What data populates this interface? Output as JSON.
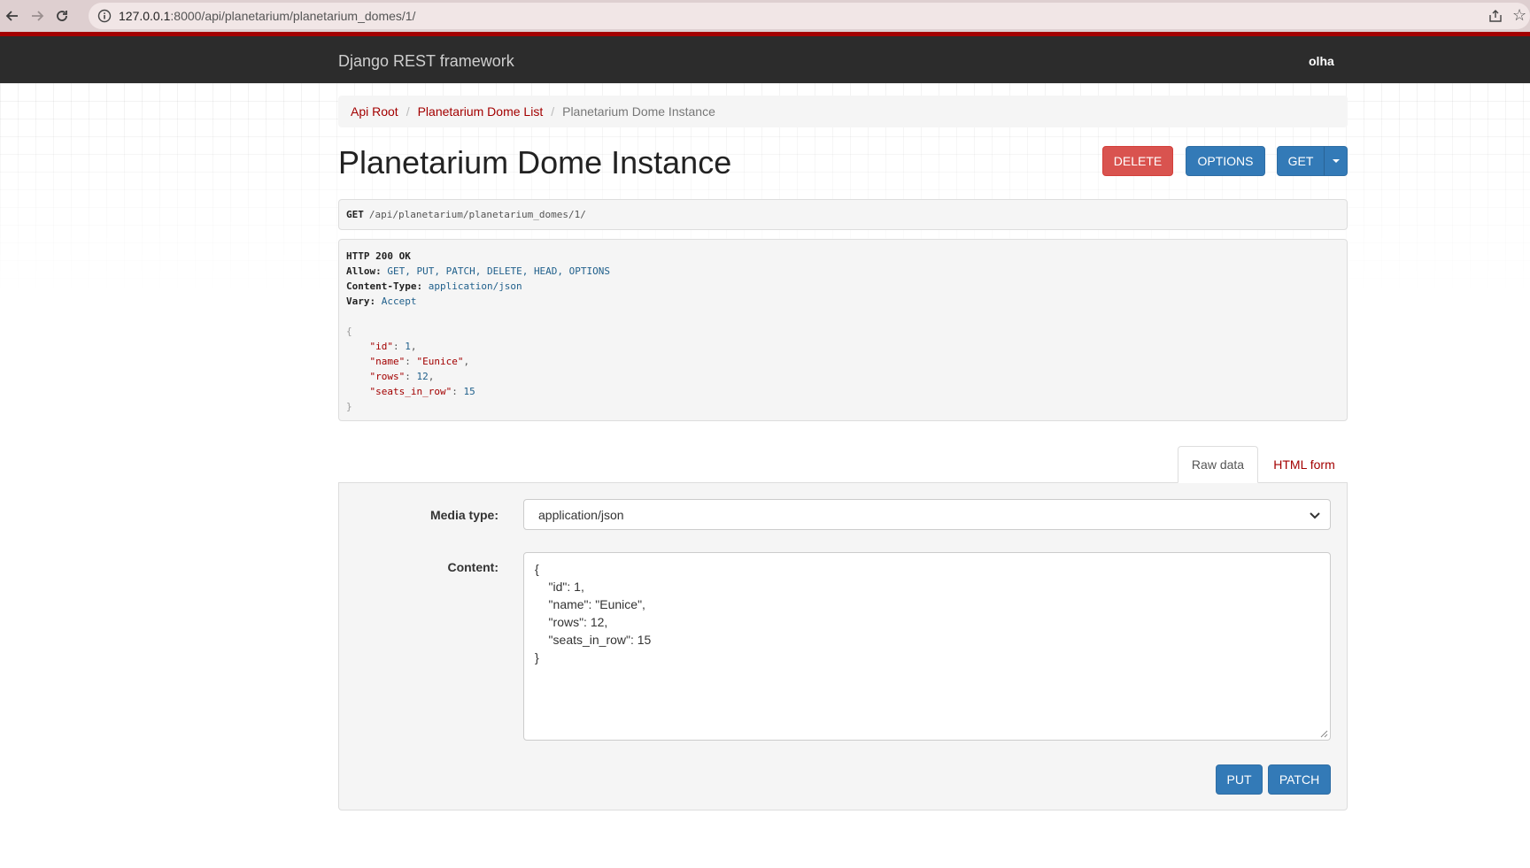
{
  "browser": {
    "url_host": "127.0.0.1",
    "url_path": ":8000/api/planetarium/planetarium_domes/1/",
    "icons": [
      "back-arrow-icon",
      "forward-arrow-icon",
      "reload-icon",
      "info-icon",
      "share-icon",
      "star-icon"
    ]
  },
  "navbar": {
    "brand": "Django REST framework",
    "user": "olha"
  },
  "breadcrumb": {
    "items": [
      "Api Root",
      "Planetarium Dome List",
      "Planetarium Dome Instance"
    ],
    "separator": "/"
  },
  "page": {
    "title": "Planetarium Dome Instance"
  },
  "actions": {
    "delete_label": "DELETE",
    "options_label": "OPTIONS",
    "get_label": "GET"
  },
  "request": {
    "method": "GET",
    "path": "/api/planetarium/planetarium_domes/1/"
  },
  "response": {
    "status": "HTTP 200 OK",
    "headers": [
      {
        "key": "Allow:",
        "value": "GET, PUT, PATCH, DELETE, HEAD, OPTIONS"
      },
      {
        "key": "Content-Type:",
        "value": "application/json"
      },
      {
        "key": "Vary:",
        "value": "Accept"
      }
    ],
    "open_brace": "{",
    "close_brace": "}",
    "fields": [
      {
        "key": "\"id\"",
        "value": "1",
        "type": "num",
        "trail": ","
      },
      {
        "key": "\"name\"",
        "value": "\"Eunice\"",
        "type": "str",
        "trail": ","
      },
      {
        "key": "\"rows\"",
        "value": "12",
        "type": "num",
        "trail": ","
      },
      {
        "key": "\"seats_in_row\"",
        "value": "15",
        "type": "num",
        "trail": ""
      }
    ]
  },
  "tabs": {
    "raw_data": "Raw data",
    "html_form": "HTML form"
  },
  "form": {
    "media_type_label": "Media type:",
    "media_type_value": "application/json",
    "content_label": "Content:",
    "content_lines": [
      "{",
      "    \"id\": 1,",
      "    \"name\": \"Eunice\",",
      "    \"rows\": 12,",
      "    \"seats_in_row\": 15",
      "}"
    ],
    "put_label": "PUT",
    "patch_label": "PATCH"
  },
  "colors": {
    "brand_red": "#a30000",
    "navbar": "#2c2c2c",
    "primary": "#337ab7",
    "danger": "#d9534f"
  }
}
